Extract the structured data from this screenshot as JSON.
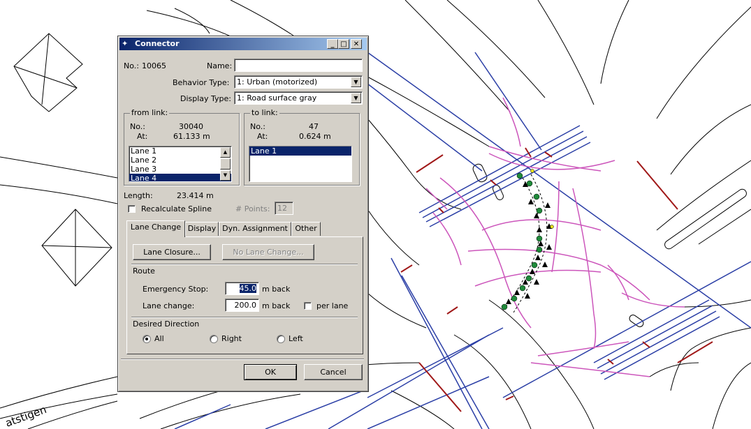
{
  "map": {
    "street_label": "atstigen"
  },
  "window": {
    "title": "Connector",
    "controls": {
      "minimize": "_",
      "maximize": "□",
      "close": "✕"
    }
  },
  "header": {
    "no_label": "No.:",
    "no_value": "10065",
    "name_label": "Name:",
    "name_value": "",
    "behavior_label": "Behavior Type:",
    "behavior_value": "1: Urban (motorized)",
    "display_label": "Display Type:",
    "display_value": "1: Road surface gray"
  },
  "from_link": {
    "title": "from link:",
    "no_label": "No.:",
    "no_value": "30040",
    "at_label": "At:",
    "at_value": "61.133 m",
    "lanes": [
      "Lane 1",
      "Lane 2",
      "Lane 3",
      "Lane 4"
    ],
    "selected_index": 3
  },
  "to_link": {
    "title": "to link:",
    "no_label": "No.:",
    "no_value": "47",
    "at_label": "At:",
    "at_value": "0.624 m",
    "lanes": [
      "Lane 1"
    ],
    "selected_index": 0
  },
  "length": {
    "label": "Length:",
    "value": "23.414 m"
  },
  "spline": {
    "label": "Recalculate Spline",
    "checked": false,
    "points_label": "# Points:",
    "points_value": "12"
  },
  "tabs": [
    {
      "label": "Lane Change",
      "active": true
    },
    {
      "label": "Display",
      "active": false
    },
    {
      "label": "Dyn. Assignment",
      "active": false
    },
    {
      "label": "Other",
      "active": false
    }
  ],
  "lane_change": {
    "lane_closure_button": "Lane Closure...",
    "no_lane_change_button": "No Lane Change...",
    "route_title": "Route",
    "emergency_label": "Emergency Stop:",
    "emergency_value": "45.0",
    "emergency_unit": "m  back",
    "lanechange_label": "Lane change:",
    "lanechange_value": "200.0",
    "lanechange_unit": "m  back",
    "per_lane_label": "per lane",
    "per_lane_checked": false,
    "direction_title": "Desired Direction",
    "directions": [
      {
        "label": "All",
        "selected": true
      },
      {
        "label": "Right",
        "selected": false
      },
      {
        "label": "Left",
        "selected": false
      }
    ]
  },
  "footer": {
    "ok_label": "OK",
    "cancel_label": "Cancel"
  },
  "colors": {
    "dialog_bg": "#d4d0c8",
    "title_start": "#0a246a",
    "title_end": "#a6caf0",
    "road_link": "#2b3fa6",
    "connector": "#cc55bb",
    "signal_head": "#a01818",
    "vehicle": "#1f8a3a"
  }
}
